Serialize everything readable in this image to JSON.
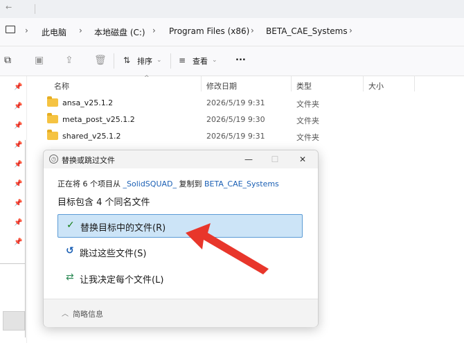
{
  "topbar": {
    "back_glyph": "←"
  },
  "address_bar": {
    "crumbs": [
      "此电脑",
      "本地磁盘 (C:)",
      "Program Files (x86)",
      "BETA_CAE_Systems"
    ]
  },
  "toolbar": {
    "sort_label": "排序",
    "view_label": "查看",
    "more_label": "..."
  },
  "file_list": {
    "columns": [
      "名称",
      "修改日期",
      "类型",
      "大小"
    ],
    "rows": [
      {
        "name": "ansa_v25.1.2",
        "date": "2026/5/19 9:31",
        "type": "文件夹"
      },
      {
        "name": "meta_post_v25.1.2",
        "date": "2026/5/19 9:30",
        "type": "文件夹"
      },
      {
        "name": "shared_v25.1.2",
        "date": "2026/5/19 9:31",
        "type": "文件夹"
      }
    ]
  },
  "dialog": {
    "title": "替换或跳过文件",
    "status_prefix": "正在将 6 个项目从 ",
    "source": "_SolidSQUAD_",
    "status_mid": " 复制到 ",
    "destination": "BETA_CAE_Systems",
    "heading": "目标包含 4 个同名文件",
    "options": {
      "replace": "替换目标中的文件(R)",
      "skip": "跳过这些文件(S)",
      "decide": "让我决定每个文件(L)"
    },
    "footer_label": "简略信息",
    "window_buttons": {
      "minimize": "—",
      "maximize": "☐",
      "close": "✕"
    }
  },
  "colors": {
    "accent_blue": "#1a5fb4",
    "selected_bg": "#cce4f7",
    "arrow_red": "#e8362b",
    "folder_yellow": "#f5c342"
  }
}
